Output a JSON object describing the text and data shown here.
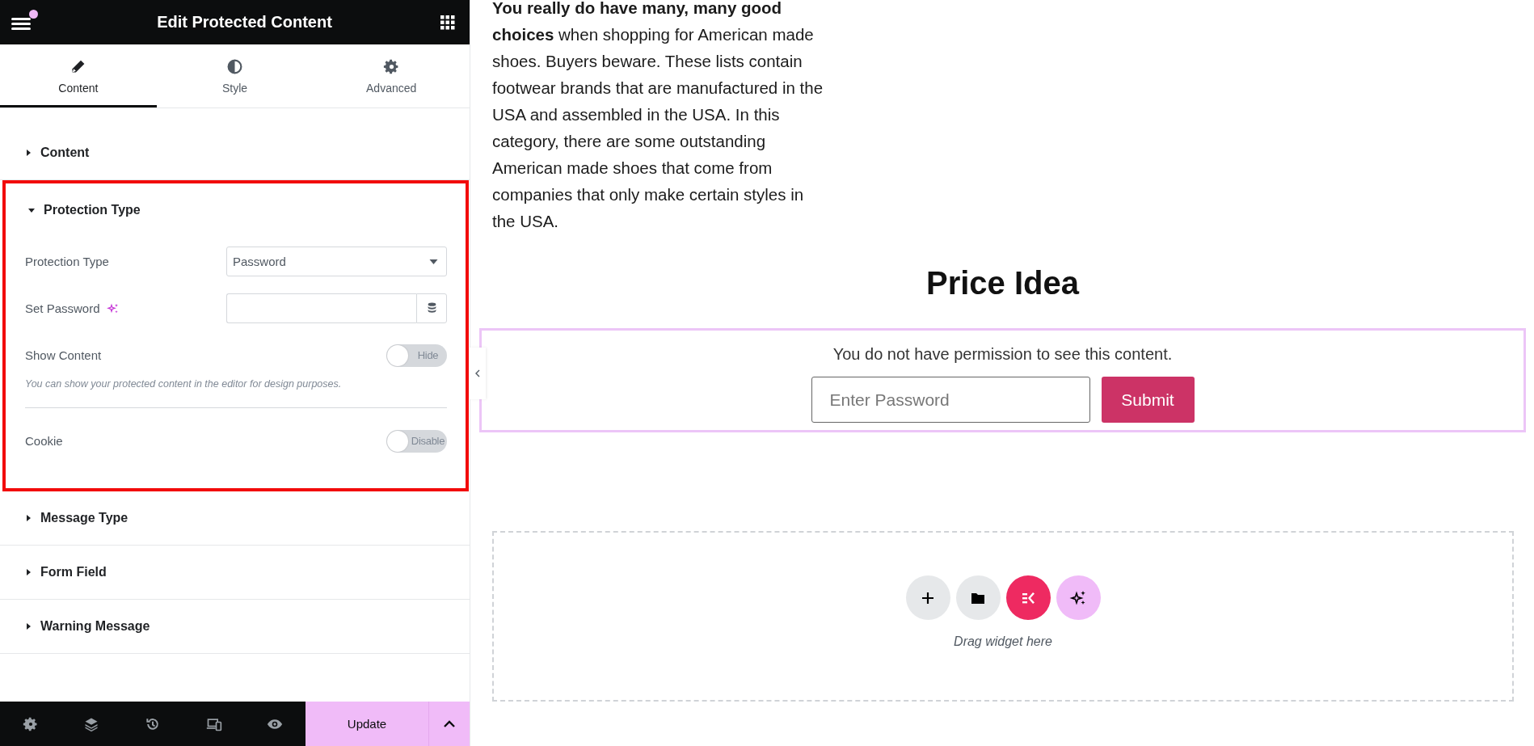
{
  "editor": {
    "title": "Edit Protected Content",
    "notification": true,
    "tabs": [
      {
        "label": "Content",
        "selected": true
      },
      {
        "label": "Style",
        "selected": false
      },
      {
        "label": "Advanced",
        "selected": false
      }
    ],
    "sections": [
      {
        "title": "Content",
        "expanded": false,
        "highlighted": false
      },
      {
        "title": "Protection Type",
        "expanded": true,
        "highlighted": true,
        "controls": [
          {
            "kind": "select",
            "label": "Protection Type",
            "value": "Password"
          },
          {
            "kind": "dynamic-text",
            "label": "Set Password",
            "ai": true
          },
          {
            "kind": "switch",
            "label": "Show Content",
            "on": false,
            "state_label": "Hide",
            "note": "You can show your protected content in the editor for design purposes."
          },
          {
            "kind": "divider"
          },
          {
            "kind": "switch",
            "label": "Cookie",
            "on": false,
            "state_label": "Disable"
          }
        ]
      },
      {
        "title": "Message Type",
        "expanded": false,
        "highlighted": false
      },
      {
        "title": "Form Field",
        "expanded": false,
        "highlighted": false
      },
      {
        "title": "Warning Message",
        "expanded": false,
        "highlighted": false
      }
    ],
    "footer": {
      "update_label": "Update"
    }
  },
  "preview": {
    "intro": "**You really do have many, many good choices** when shopping for American made shoes. Buyers beware. These lists contain footwear brands that are manufactured in the USA and assembled in the USA. In this category, there are some outstanding American made shoes that come from companies that only make certain styles in the USA.",
    "heading": "Price Idea",
    "protected": {
      "message": "You do not have permission to see this content.",
      "placeholder": "Enter Password",
      "submit": "Submit"
    },
    "dropzone": {
      "hint": "Drag widget here"
    }
  }
}
